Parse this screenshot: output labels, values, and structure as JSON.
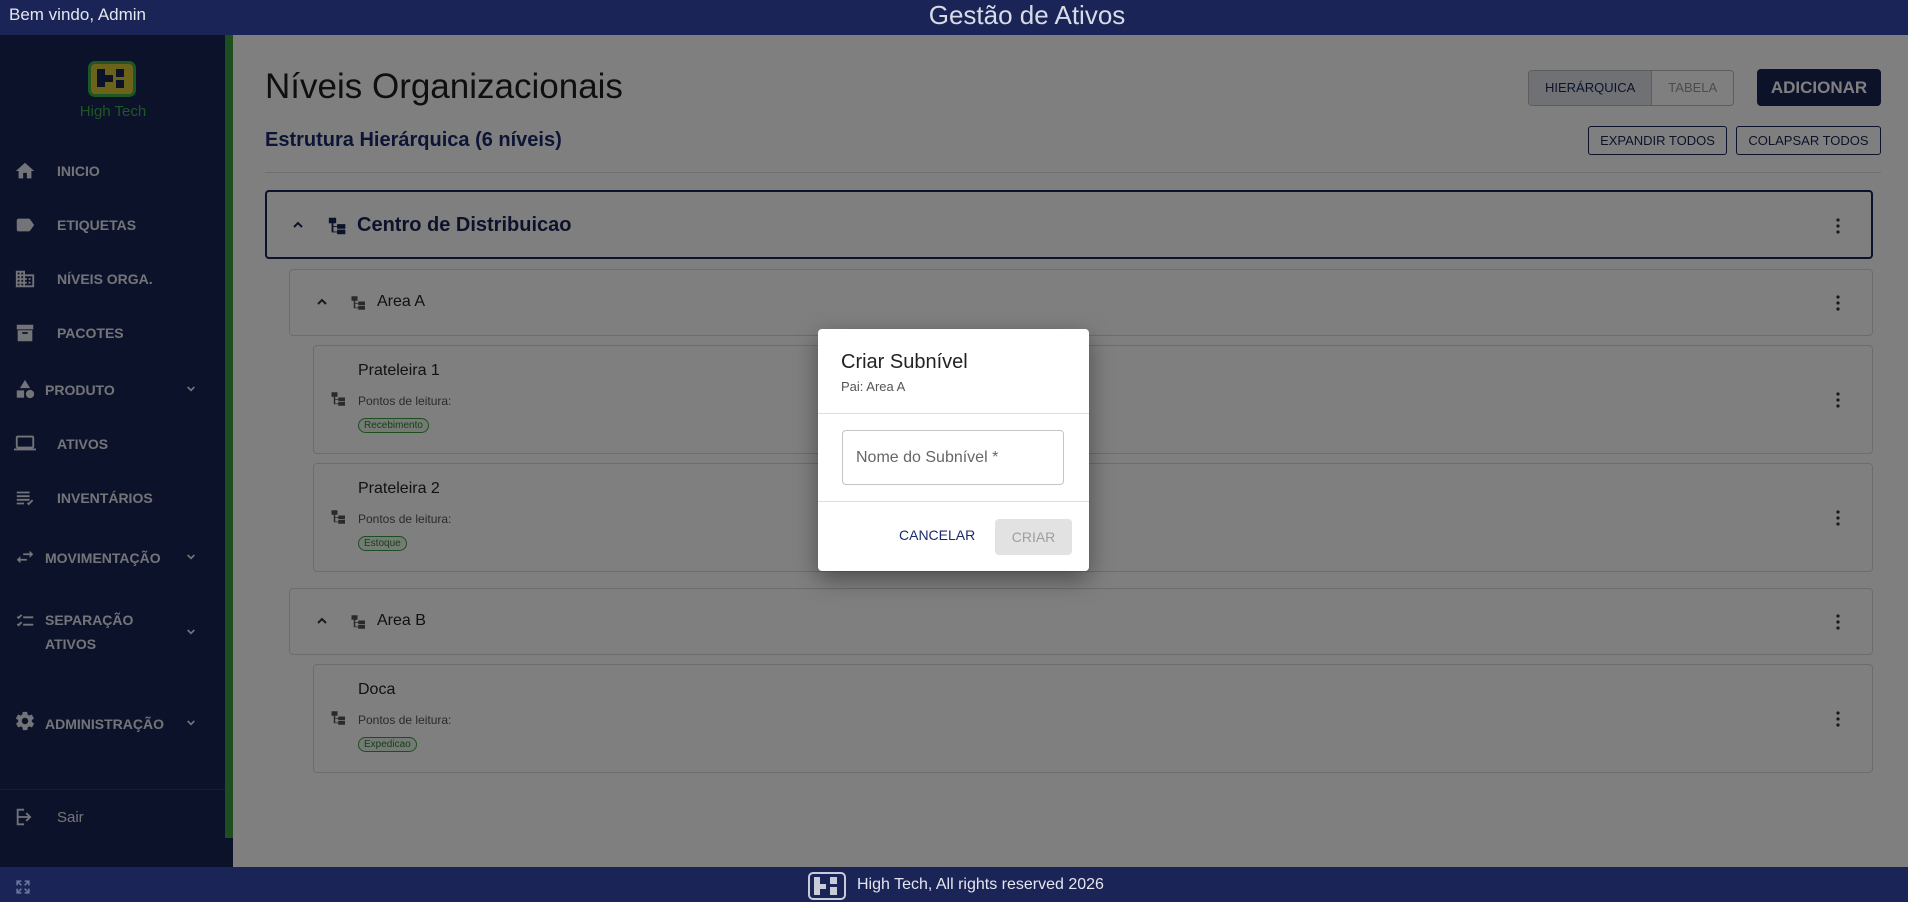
{
  "topbar": {
    "welcome": "Bem vindo, Admin",
    "app_title": "Gestão de Ativos"
  },
  "sidebar": {
    "logo_text": "High Tech",
    "items": [
      {
        "label": "INICIO",
        "icon": "home-icon"
      },
      {
        "label": "ETIQUETAS",
        "icon": "label-icon"
      },
      {
        "label": "NÍVEIS ORGA.",
        "icon": "building-icon"
      },
      {
        "label": "PACOTES",
        "icon": "archive-icon"
      },
      {
        "label": "PRODUTO",
        "icon": "shapes-icon",
        "expandable": true
      },
      {
        "label": "ATIVOS",
        "icon": "laptop-icon"
      },
      {
        "label": "INVENTÁRIOS",
        "icon": "checklist-icon"
      },
      {
        "label": "MOVIMENTAÇÃO",
        "icon": "swap-icon",
        "expandable": true
      },
      {
        "label_line1": "SEPARAÇÃO",
        "label_line2": "ATIVOS",
        "icon": "list-check-icon",
        "expandable": true
      },
      {
        "label": "ADMINISTRAÇÃO",
        "icon": "gear-icon",
        "expandable": true
      }
    ],
    "logout": "Sair"
  },
  "main": {
    "title": "Níveis Organizacionais",
    "subtitle": "Estrutura Hierárquica (6 níveis)",
    "view_toggle": {
      "hierarchical": "HIERÁRQUICA",
      "table": "TABELA",
      "selected": "HIERÁRQUICA"
    },
    "add_button": "ADICIONAR",
    "expand_all": "EXPANDIR TODOS",
    "collapse_all": "COLAPSAR TODOS",
    "tree": {
      "root": "Centro de Distribuicao",
      "area_a": "Area A",
      "prateleira1": {
        "name": "Prateleira 1",
        "points_label": "Pontos de leitura:",
        "tag": "Recebimento"
      },
      "prateleira2": {
        "name": "Prateleira 2",
        "points_label": "Pontos de leitura:",
        "tag": "Estoque"
      },
      "area_b": "Area B",
      "doca": {
        "name": "Doca",
        "points_label": "Pontos de leitura:",
        "tag": "Expedicao"
      }
    }
  },
  "dialog": {
    "title": "Criar Subnível",
    "parent": "Pai: Area A",
    "field_placeholder": "Nome do Subnível *",
    "cancel": "CANCELAR",
    "create": "CRIAR"
  },
  "footer": {
    "text": "High Tech, All rights reserved 2026"
  },
  "colors": {
    "navy": "#1a2456",
    "green_accent": "#3b9d3f",
    "logo_yellow": "#d8c636"
  }
}
